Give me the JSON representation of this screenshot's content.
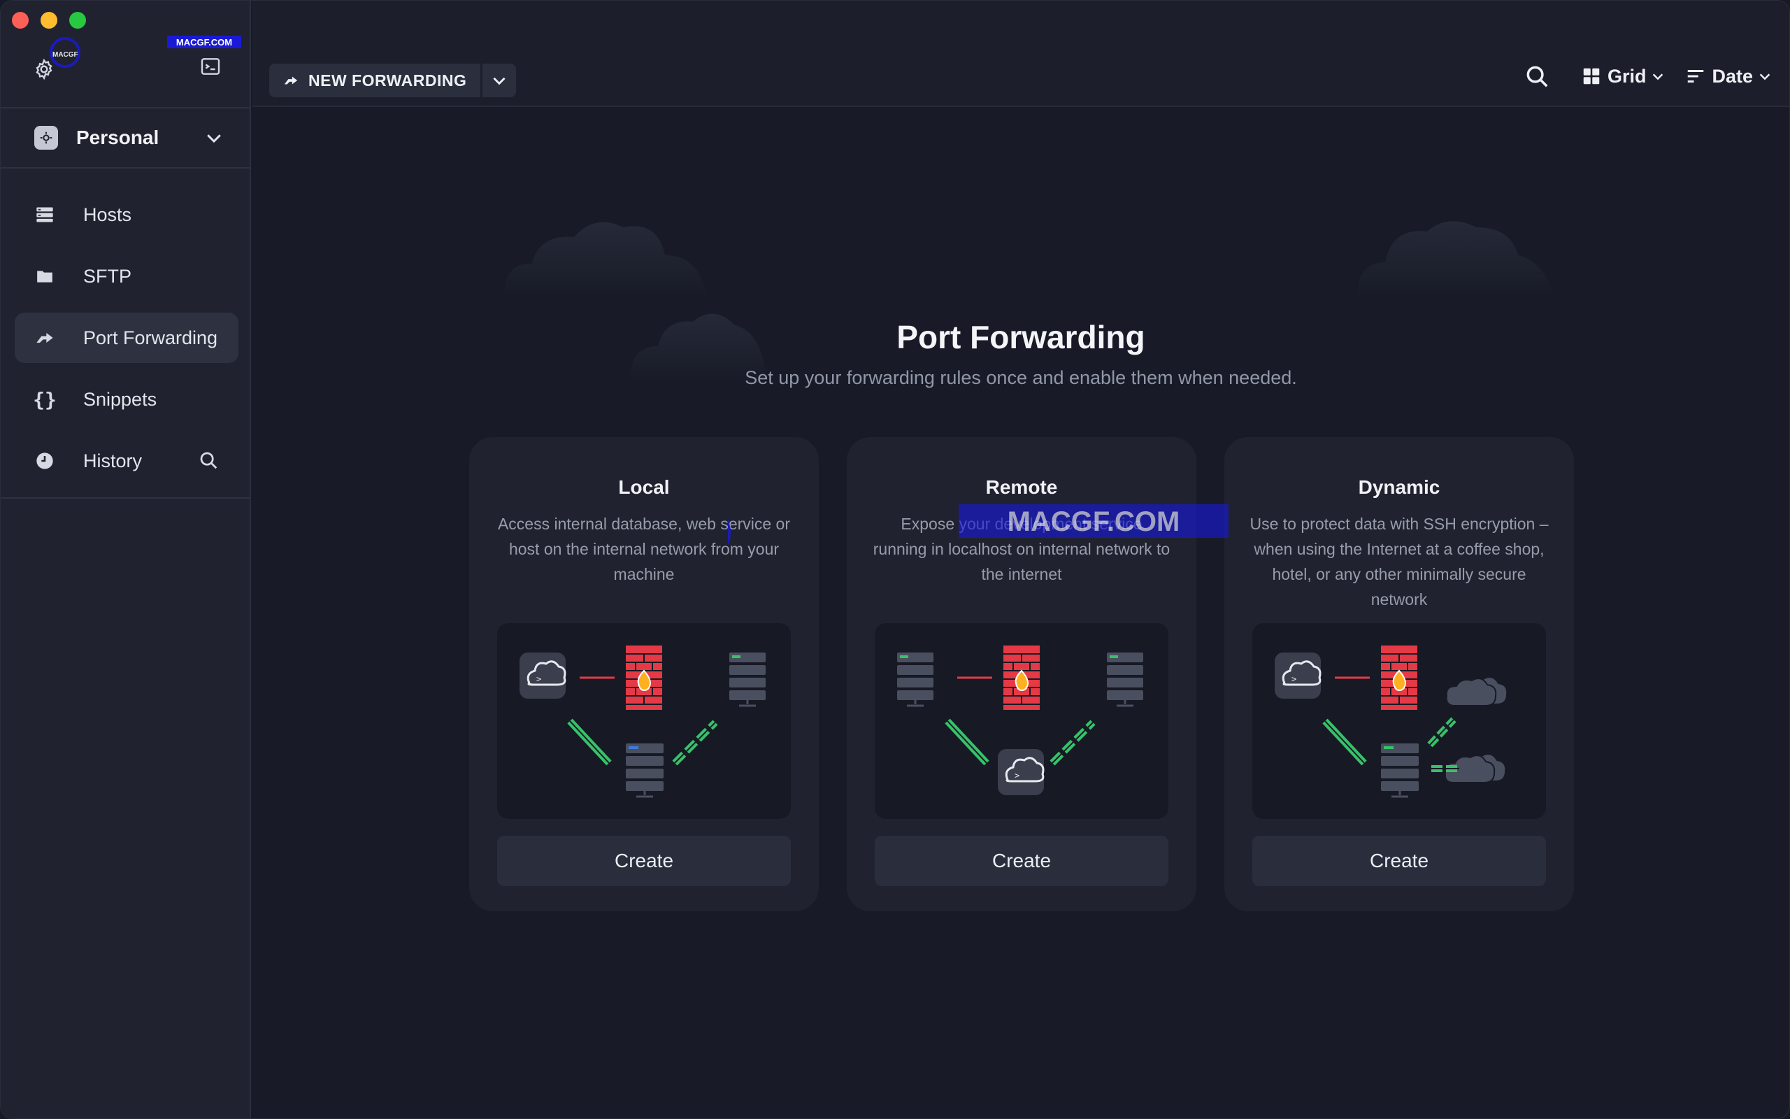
{
  "sidebar": {
    "vault_label": "Personal",
    "items": [
      {
        "label": "Hosts",
        "icon": "hosts-icon"
      },
      {
        "label": "SFTP",
        "icon": "folder-icon"
      },
      {
        "label": "Port Forwarding",
        "icon": "port-forwarding-icon",
        "active": true
      },
      {
        "label": "Snippets",
        "icon": "braces-icon"
      },
      {
        "label": "History",
        "icon": "clock-icon"
      }
    ]
  },
  "toolbar": {
    "new_forwarding_label": "NEW FORWARDING",
    "view_label": "Grid",
    "sort_label": "Date"
  },
  "hero": {
    "title": "Port Forwarding",
    "subtitle": "Set up your forwarding rules once and enable them when needed."
  },
  "cards": [
    {
      "title": "Local",
      "description": "Access internal database, web service or host on the internal network from your machine",
      "button": "Create"
    },
    {
      "title": "Remote",
      "description": "Expose your development service running in localhost on internal network to the internet",
      "button": "Create"
    },
    {
      "title": "Dynamic",
      "description": "Use to protect data with SSH encryption – when using the Internet at a coffee shop, hotel, or any other minimally secure network",
      "button": "Create"
    }
  ],
  "watermark": {
    "text": "MACGF.COM",
    "logo_text": "MACGF"
  },
  "colors": {
    "accent_red": "#e63946",
    "accent_green": "#37c26a",
    "background": "#181b27",
    "sidebar": "#20232f",
    "card": "#20232f",
    "watermark_blue": "#1a1ad6"
  }
}
